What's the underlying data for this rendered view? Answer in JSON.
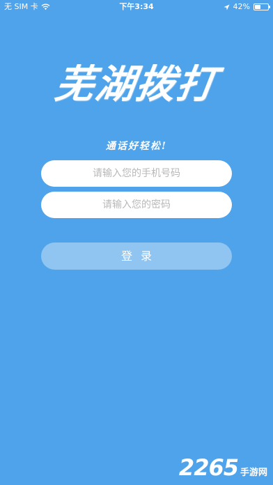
{
  "status_bar": {
    "carrier": "无 SIM 卡",
    "time": "下午3:34",
    "battery_percent": "42%",
    "battery_level": 0.42
  },
  "app": {
    "title": "芜湖拨打",
    "slogan": "通话好轻松!"
  },
  "login_form": {
    "phone_placeholder": "请输入您的手机号码",
    "password_placeholder": "请输入您的密码",
    "login_button": "登录"
  },
  "watermark": {
    "number": "2265",
    "site": "手游网"
  },
  "colors": {
    "background": "#4ea3ea",
    "button": "#8fc5f0",
    "input": "#ffffff"
  },
  "icons": [
    "wifi-icon",
    "location-icon",
    "battery-icon"
  ]
}
